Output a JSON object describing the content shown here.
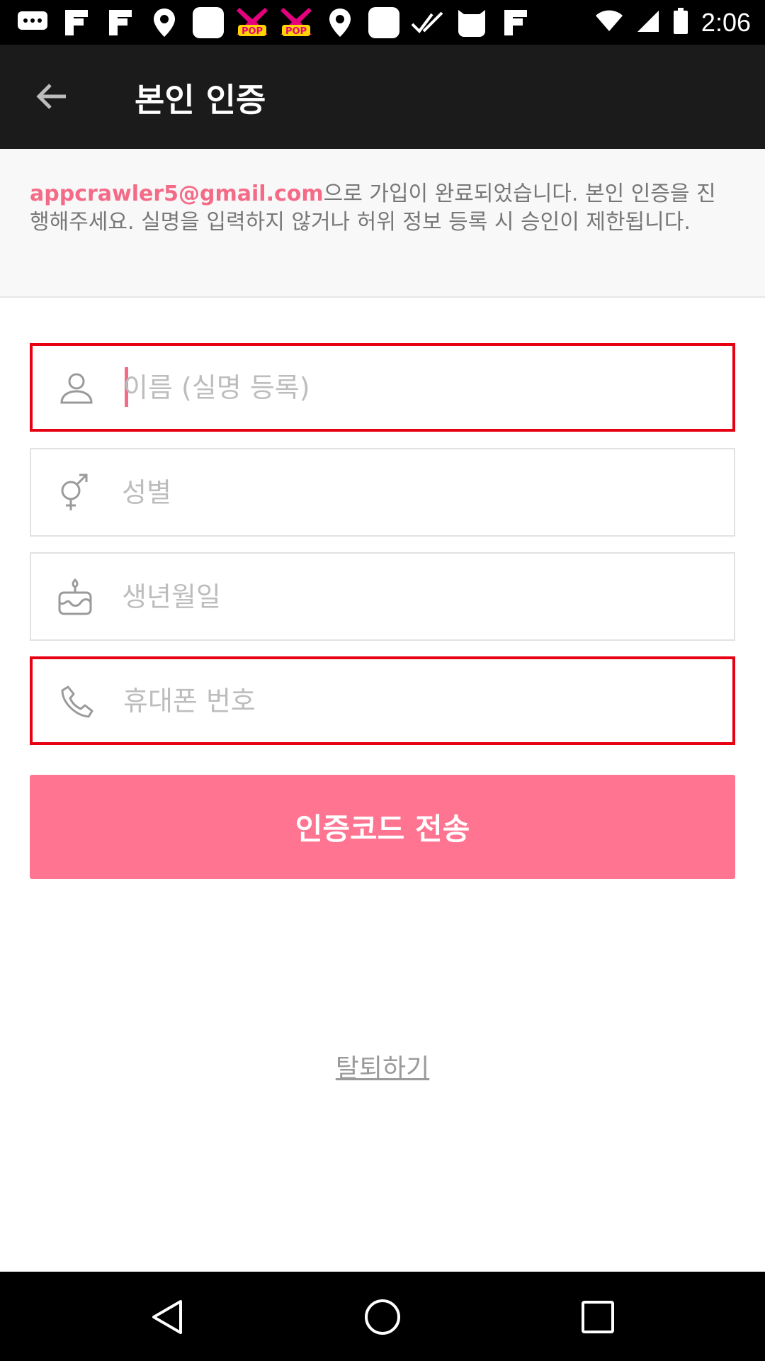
{
  "status_bar": {
    "time": "2:06",
    "notification_icons": [
      "chat-bubble-icon",
      "flipboard-icon",
      "flipboard-icon",
      "location-pin-icon",
      "app-square-icon",
      "pop-ribbon-icon",
      "pop-ribbon-icon",
      "location-pin-icon",
      "app-square-icon",
      "check-icon",
      "cat-icon",
      "flipboard-icon"
    ],
    "status_icons": [
      "wifi-icon",
      "signal-icon",
      "battery-icon"
    ]
  },
  "app_bar": {
    "title": "본인 인증",
    "back_icon": "arrow-left-icon"
  },
  "notice": {
    "email": "appcrawler5@gmail.com",
    "message": "으로 가입이 완료되었습니다. 본인 인증을 진행해주세요. 실명을 입력하지 않거나 허위 정보 등록 시 승인이 제한됩니다."
  },
  "form": {
    "name": {
      "placeholder": "이름 (실명 등록)",
      "icon": "person-icon",
      "value": ""
    },
    "gender": {
      "placeholder": "성별",
      "icon": "gender-icon",
      "value": ""
    },
    "birthday": {
      "placeholder": "생년월일",
      "icon": "cake-icon",
      "value": ""
    },
    "phone": {
      "placeholder": "휴대폰 번호",
      "icon": "phone-icon",
      "value": ""
    }
  },
  "send_button": {
    "label": "인증코드 전송"
  },
  "withdraw_link": {
    "label": "탈퇴하기"
  },
  "colors": {
    "accent_pink": "#ff7490",
    "email_pink": "#f46b88",
    "error_red": "#e60012",
    "app_bar_bg": "#1b1b1b"
  },
  "nav_bar": {
    "buttons": [
      "back-triangle-icon",
      "home-circle-icon",
      "recents-square-icon"
    ]
  }
}
